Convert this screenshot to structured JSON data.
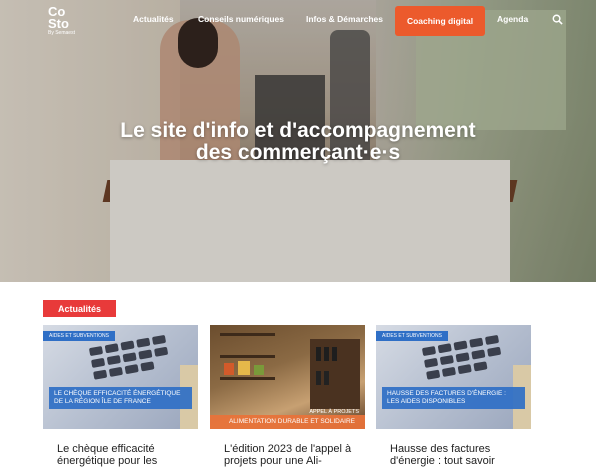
{
  "logo": {
    "line1": "Co",
    "line2": "Sto",
    "tagline": "By Semaest"
  },
  "nav": {
    "items": [
      "Actualités",
      "Conseils numériques",
      "Infos & Démarches"
    ],
    "coaching": "Coaching digital",
    "agenda": "Agenda",
    "search_icon": "search-icon"
  },
  "hero": {
    "title_line1": "Le site d'info et d'accompagnement",
    "title_line2": "des commerçant·e·s"
  },
  "section": {
    "label": "Actualités"
  },
  "cards": [
    {
      "tag": "AIDES ET SUBVENTIONS",
      "caption": "LE CHÈQUE EFFICACITÉ ÉNERGÉTIQUE DE LA RÉGION ÎLE DE FRANCE",
      "title": "Le chèque efficacité énergétique pour les"
    },
    {
      "tag": "APPEL À PROJETS",
      "caption": "ALIMENTATION DURABLE ET SOLIDAIRE",
      "title": "L'édition 2023 de l'appel à projets pour une Ali-"
    },
    {
      "tag": "AIDES ET SUBVENTIONS",
      "caption": "HAUSSE DES FACTURES D'ÉNERGIE : LES AIDES DISPONIBLES",
      "title": "Hausse des factures d'énergie : tout savoir"
    }
  ],
  "colors": {
    "accent": "#ec5a2c",
    "section_red": "#e83a3a",
    "tag_blue": "#2f6fc6",
    "caption_orange": "#e8733a"
  }
}
